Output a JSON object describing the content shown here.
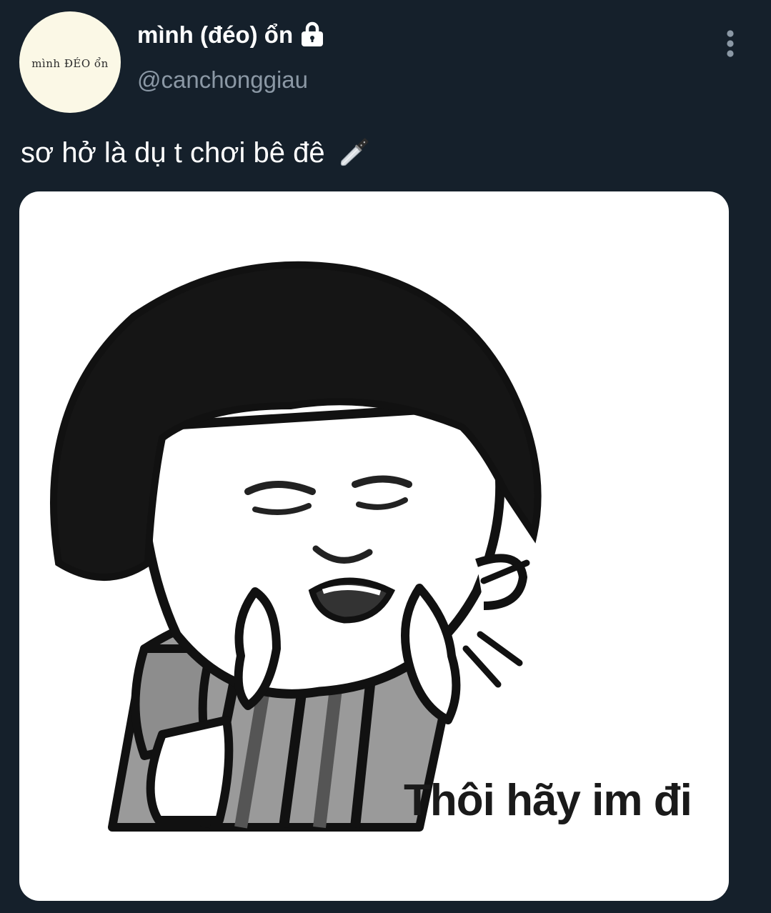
{
  "user": {
    "avatar_text": "mình ĐÉO ổn",
    "display_name": "mình (đéo) ổn",
    "handle": "@canchonggiau",
    "protected_icon": "lock-icon"
  },
  "tweet": {
    "text": "sơ hở là dụ t chơi bê đê",
    "emoji": "knife-icon",
    "more_icon": "more-vertical-icon"
  },
  "media": {
    "caption": "Thôi hãy im đi"
  },
  "colors": {
    "background": "#15202b",
    "text_primary": "#ffffff",
    "text_secondary": "#8b98a5"
  }
}
